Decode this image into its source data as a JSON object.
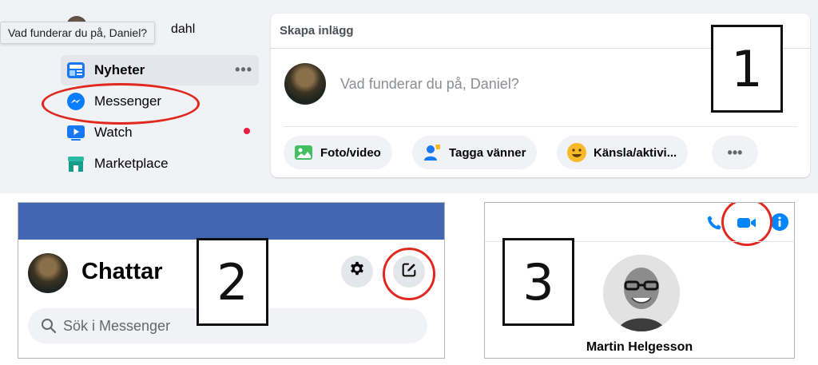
{
  "panel1": {
    "tooltip": "Vad funderar du på, Daniel?",
    "profile_name_fragment": "dahl",
    "sidebar": {
      "items": [
        {
          "label": "Nyheter",
          "icon": "news-feed-icon"
        },
        {
          "label": "Messenger",
          "icon": "messenger-icon"
        },
        {
          "label": "Watch",
          "icon": "watch-icon"
        },
        {
          "label": "Marketplace",
          "icon": "marketplace-icon"
        }
      ],
      "more": "•••"
    },
    "create_post": {
      "header": "Skapa inlägg",
      "placeholder": "Vad funderar du på, Daniel?",
      "actions": [
        {
          "label": "Foto/video",
          "icon": "photo-icon"
        },
        {
          "label": "Tagga vänner",
          "icon": "tag-friends-icon"
        },
        {
          "label": "Känsla/aktivi...",
          "icon": "feeling-icon"
        }
      ],
      "more": "•••"
    },
    "number": "1"
  },
  "panel2": {
    "title": "Chattar",
    "search_placeholder": "Sök i Messenger",
    "number": "2"
  },
  "panel3": {
    "contact_name": "Martin Helgesson",
    "number": "3"
  },
  "colors": {
    "fb_blue": "#4267b2",
    "messenger_blue": "#0084ff",
    "annotation_red": "#e0281e",
    "notification_red": "#e41e3f"
  }
}
